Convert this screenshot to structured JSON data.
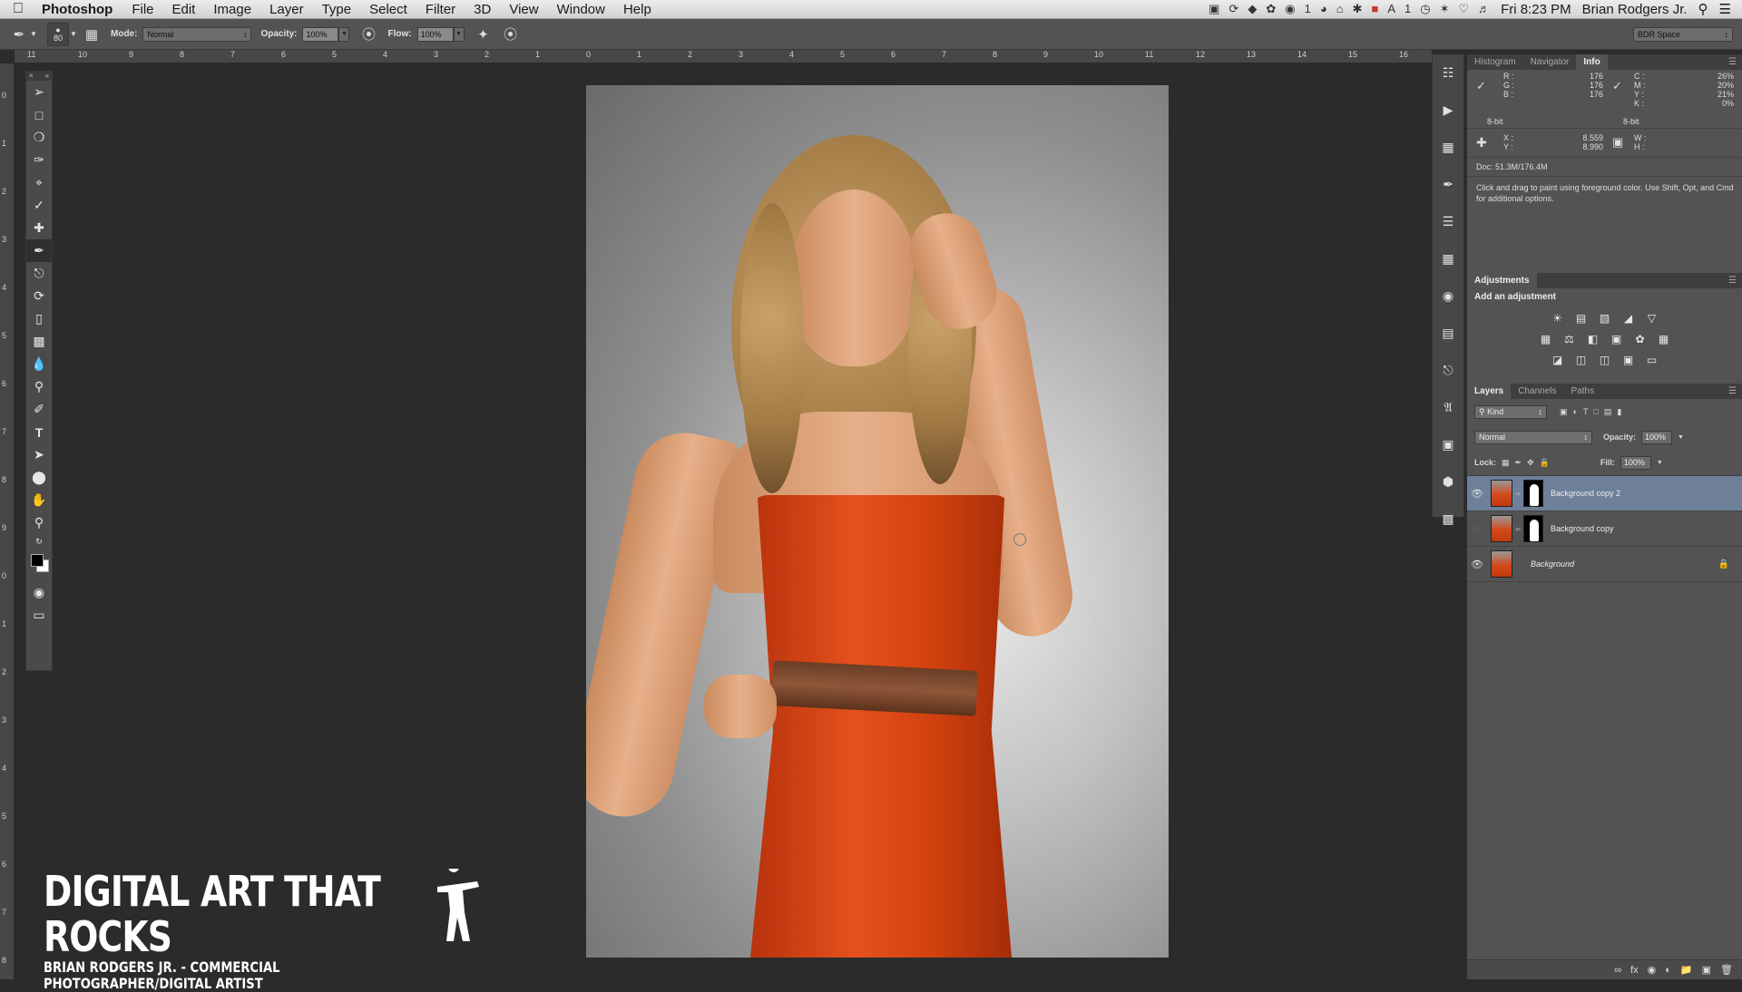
{
  "menubar": {
    "app_name": "Photoshop",
    "items": [
      "File",
      "Edit",
      "Image",
      "Layer",
      "Type",
      "Select",
      "Filter",
      "3D",
      "View",
      "Window",
      "Help"
    ],
    "tray": {
      "badge_count": "1",
      "ai_badge": "1"
    },
    "clock": "Fri 8:23 PM",
    "user": "Brian Rodgers Jr."
  },
  "options": {
    "brush_size": "80",
    "mode_label": "Mode:",
    "mode_value": "Normal",
    "opacity_label": "Opacity:",
    "opacity_value": "100%",
    "flow_label": "Flow:",
    "flow_value": "100%",
    "workspace": "BDR Space"
  },
  "rulers": {
    "top": [
      "11",
      "10",
      "9",
      "8",
      "7",
      "6",
      "5",
      "4",
      "3",
      "2",
      "1",
      "0",
      "1",
      "2",
      "3",
      "4",
      "5",
      "6",
      "7",
      "8",
      "9",
      "10",
      "11",
      "12",
      "13",
      "14",
      "15",
      "16"
    ],
    "left": [
      "0",
      "1",
      "2",
      "3",
      "4",
      "5",
      "6",
      "7",
      "8",
      "9",
      "0",
      "1",
      "2",
      "3",
      "4",
      "5",
      "6",
      "7",
      "8"
    ]
  },
  "watermark": {
    "title": "DIGITAL ART THAT ROCKS",
    "subtitle": "BRIAN RODGERS JR. - COMMERCIAL PHOTOGRAPHER/DIGITAL ARTIST"
  },
  "info_panel": {
    "tabs": [
      "Histogram",
      "Navigator",
      "Info"
    ],
    "active_tab": "Info",
    "rgb": {
      "R": "176",
      "G": "176",
      "B": "176"
    },
    "cmyk": {
      "C": "26%",
      "M": "20%",
      "Y": "21%",
      "K": "0%"
    },
    "bit_left": "8-bit",
    "bit_right": "8-bit",
    "xy": {
      "X": "8.559",
      "Y": "8.990"
    },
    "wh": {
      "W": "",
      "H": ""
    },
    "doc": "Doc: 51.3M/176.4M",
    "hint": "Click and drag to paint using foreground color.  Use Shift, Opt, and Cmd for additional options."
  },
  "adjustments": {
    "title": "Adjustments",
    "subtitle": "Add an adjustment"
  },
  "layers_panel": {
    "tabs": [
      "Layers",
      "Channels",
      "Paths"
    ],
    "active_tab": "Layers",
    "filter": "Kind",
    "blend_mode": "Normal",
    "opacity_label": "Opacity:",
    "opacity_value": "100%",
    "lock_label": "Lock:",
    "fill_label": "Fill:",
    "fill_value": "100%",
    "layers": [
      {
        "name": "Background copy 2",
        "visible": true,
        "selected": true
      },
      {
        "name": "Background copy",
        "visible": false,
        "selected": false
      },
      {
        "name": "Background",
        "visible": true,
        "selected": false
      }
    ]
  }
}
